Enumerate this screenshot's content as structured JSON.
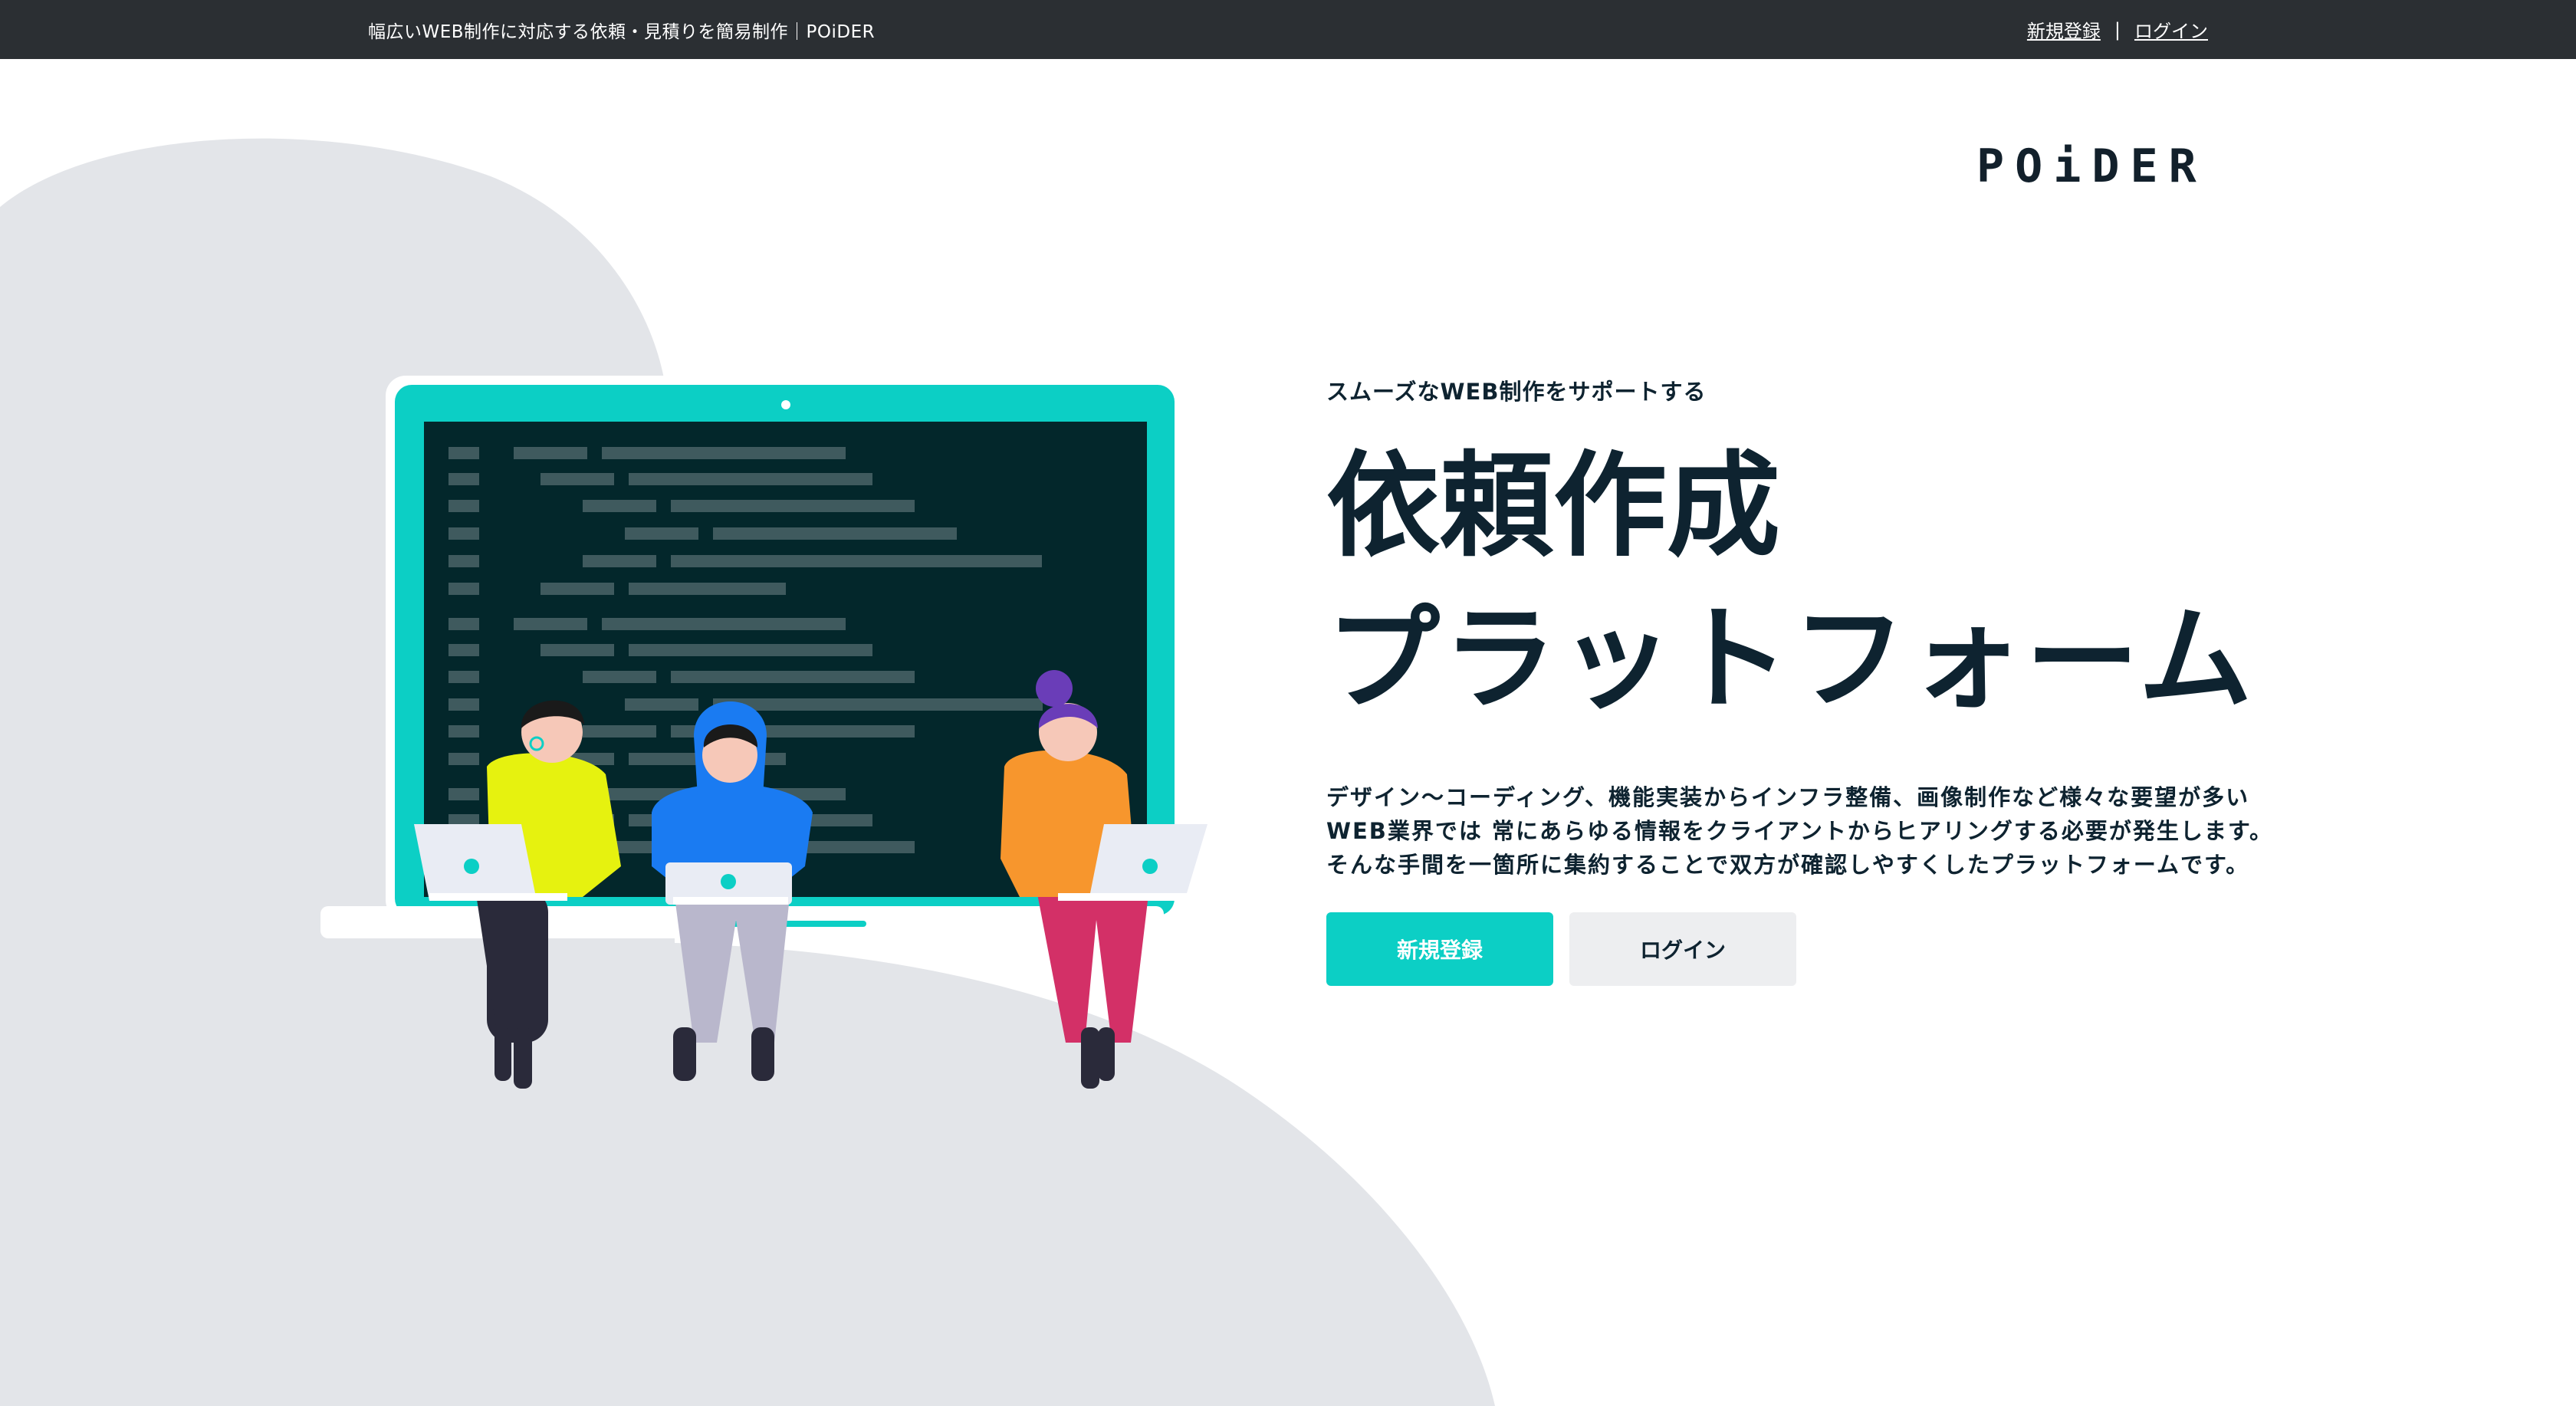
{
  "topbar": {
    "tagline": "幅広いWEB制作に対応する依頼・見積りを簡易制作｜POiDER",
    "signup_link": "新規登録",
    "separator": "|",
    "login_link": "ログイン"
  },
  "logo": {
    "text_a": "POi",
    "text_b": "DER"
  },
  "hero": {
    "kicker": "スムーズなWEB制作をサポートする",
    "title_line1": "依頼作成",
    "title_line2": "プラットフォーム",
    "desc_line1": "デザイン〜コーディング、機能実装からインフラ整備、画像制作など様々な要望が多い",
    "desc_line2": "WEB業界では 常にあらゆる情報をクライアントからヒアリングする必要が発生します。",
    "desc_line3": "そんな手間を一箇所に集約することで双方が確認しやすくしたプラットフォームです。",
    "signup_button": "新規登録",
    "login_button": "ログイン"
  },
  "colors": {
    "accent": "#0ccfc5",
    "topbar": "#2b2f33",
    "text": "#0e2330",
    "background_shape": "#e3e5e9"
  },
  "icons": [
    "laptop-illustration",
    "people-illustration"
  ]
}
